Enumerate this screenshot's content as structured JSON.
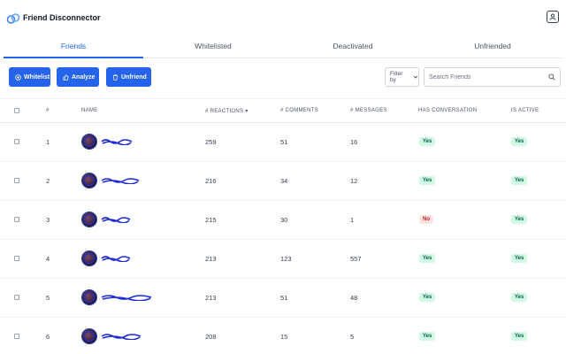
{
  "app": {
    "title": "Friend Disconnector",
    "logo_icon": "link-icon",
    "account_icon": "user-icon"
  },
  "tabs": [
    {
      "label": "Friends",
      "active": true
    },
    {
      "label": "Whitelisted",
      "active": false
    },
    {
      "label": "Deactivated",
      "active": false
    },
    {
      "label": "Unfriended",
      "active": false
    }
  ],
  "toolbar": {
    "whitelist_label": "Whitelist",
    "analyze_label": "Analyze",
    "unfriend_label": "Unfriend",
    "filter_label": "Filter by",
    "search_placeholder": "Search Friends"
  },
  "table": {
    "columns": {
      "index": "#",
      "name": "NAME",
      "reactions": "# REACTIONS",
      "comments": "# COMMENTS",
      "messages": "# MESSAGES",
      "conversation": "HAS CONVERSATION",
      "active": "IS ACTIVE"
    },
    "sort_indicator": "▾",
    "rows": [
      {
        "index": "1",
        "reactions": "259",
        "comments": "51",
        "messages": "16",
        "conversation": "Yes",
        "active": "Yes"
      },
      {
        "index": "2",
        "reactions": "216",
        "comments": "34",
        "messages": "12",
        "conversation": "Yes",
        "active": "Yes"
      },
      {
        "index": "3",
        "reactions": "215",
        "comments": "30",
        "messages": "1",
        "conversation": "No",
        "active": "Yes"
      },
      {
        "index": "4",
        "reactions": "213",
        "comments": "123",
        "messages": "557",
        "conversation": "Yes",
        "active": "Yes"
      },
      {
        "index": "5",
        "reactions": "213",
        "comments": "51",
        "messages": "48",
        "conversation": "Yes",
        "active": "Yes"
      },
      {
        "index": "6",
        "reactions": "208",
        "comments": "15",
        "messages": "5",
        "conversation": "Yes",
        "active": "Yes"
      }
    ]
  },
  "colors": {
    "accent": "#2563eb",
    "yes_bg": "#d1fae5",
    "yes_text": "#065f46",
    "no_bg": "#fee2e2",
    "no_text": "#b91c1c"
  }
}
